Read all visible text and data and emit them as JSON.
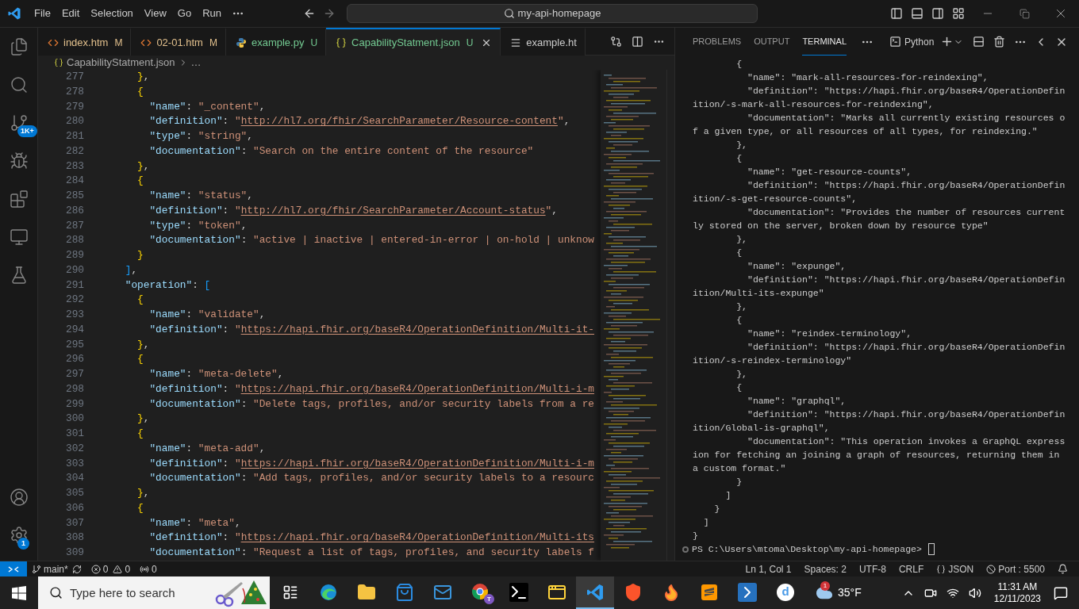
{
  "title_bar": {
    "menu": [
      "File",
      "Edit",
      "Selection",
      "View",
      "Go",
      "Run"
    ],
    "command_center": "my-api-homepage"
  },
  "activity_bar": {
    "top": [
      {
        "kind": "explorer"
      },
      {
        "kind": "search"
      },
      {
        "kind": "source_control",
        "badge": "1K+"
      },
      {
        "kind": "run"
      },
      {
        "kind": "extensions"
      },
      {
        "kind": "remote"
      },
      {
        "kind": "testing"
      }
    ],
    "bottom": [
      {
        "kind": "account"
      },
      {
        "kind": "settings",
        "badge": "1"
      }
    ]
  },
  "editor_tabs": [
    {
      "label": "index.htm",
      "kind": "html",
      "status": "M",
      "color": "#e2c08d",
      "selected": false
    },
    {
      "label": "02-01.htm",
      "kind": "html",
      "status": "M",
      "color": "#e2c08d",
      "selected": false
    },
    {
      "label": "example.py",
      "kind": "python",
      "status": "U",
      "color": "#73c991",
      "selected": false
    },
    {
      "label": "CapabilityStatment.json",
      "kind": "json",
      "status": "U",
      "color": "#73c991",
      "selected": true
    },
    {
      "label": "example.ht",
      "kind": "text",
      "color": "#cccccc",
      "selected": false
    }
  ],
  "breadcrumb": [
    "CapabilityStatment.json",
    "…"
  ],
  "editor": {
    "lines": [
      {
        "number": "277",
        "tokens": [
          {
            "kind": "close_brace",
            "text": "}"
          },
          {
            "kind": "punct",
            "text": ","
          }
        ]
      },
      {
        "number": "278",
        "tokens": [
          {
            "kind": "open_brace",
            "text": "{"
          }
        ]
      },
      {
        "number": "279",
        "tokens": [
          {
            "kind": "key",
            "text": "\"name\""
          },
          {
            "kind": "punct",
            "text": ": "
          },
          {
            "kind": "string",
            "text": "\"_content\""
          },
          {
            "kind": "punct",
            "text": ","
          }
        ]
      },
      {
        "number": "280",
        "tokens": [
          {
            "kind": "key",
            "text": "\"definition\""
          },
          {
            "kind": "punct",
            "text": ": "
          },
          {
            "kind": "string",
            "text": "\""
          },
          {
            "kind": "link",
            "text": "http://hl7.org/fhir/SearchParameter/Resource-content"
          },
          {
            "kind": "string",
            "text": "\""
          },
          {
            "kind": "punct",
            "text": ","
          }
        ]
      },
      {
        "number": "281",
        "tokens": [
          {
            "kind": "key",
            "text": "\"type\""
          },
          {
            "kind": "punct",
            "text": ": "
          },
          {
            "kind": "string",
            "text": "\"string\""
          },
          {
            "kind": "punct",
            "text": ","
          }
        ]
      },
      {
        "number": "282",
        "tokens": [
          {
            "kind": "key",
            "text": "\"documentation\""
          },
          {
            "kind": "punct",
            "text": ": "
          },
          {
            "kind": "string",
            "text": "\"Search on the entire content of the resource\""
          }
        ]
      },
      {
        "number": "283",
        "tokens": [
          {
            "kind": "close_brace",
            "text": "}"
          },
          {
            "kind": "punct",
            "text": ","
          }
        ]
      },
      {
        "number": "284",
        "tokens": [
          {
            "kind": "open_brace",
            "text": "{"
          }
        ]
      },
      {
        "number": "285",
        "tokens": [
          {
            "kind": "key",
            "text": "\"name\""
          },
          {
            "kind": "punct",
            "text": ": "
          },
          {
            "kind": "string",
            "text": "\"status\""
          },
          {
            "kind": "punct",
            "text": ","
          }
        ]
      },
      {
        "number": "286",
        "tokens": [
          {
            "kind": "key",
            "text": "\"definition\""
          },
          {
            "kind": "punct",
            "text": ": "
          },
          {
            "kind": "string",
            "text": "\""
          },
          {
            "kind": "link",
            "text": "http://hl7.org/fhir/SearchParameter/Account-status"
          },
          {
            "kind": "string",
            "text": "\""
          },
          {
            "kind": "punct",
            "text": ","
          }
        ]
      },
      {
        "number": "287",
        "tokens": [
          {
            "kind": "key",
            "text": "\"type\""
          },
          {
            "kind": "punct",
            "text": ": "
          },
          {
            "kind": "string",
            "text": "\"token\""
          },
          {
            "kind": "punct",
            "text": ","
          }
        ]
      },
      {
        "number": "288",
        "tokens": [
          {
            "kind": "key",
            "text": "\"documentation\""
          },
          {
            "kind": "punct",
            "text": ": "
          },
          {
            "kind": "string",
            "text": "\"active | inactive | entered-in-error | on-hold | unknow"
          }
        ]
      },
      {
        "number": "289",
        "tokens": [
          {
            "kind": "close_brace",
            "text": "}"
          }
        ]
      },
      {
        "number": "290",
        "tokens": [
          {
            "kind": "close_bracket",
            "text": "]"
          },
          {
            "kind": "punct",
            "text": ","
          }
        ]
      },
      {
        "number": "291",
        "tokens": [
          {
            "kind": "key",
            "text": "\"operation\""
          },
          {
            "kind": "punct",
            "text": ": "
          },
          {
            "kind": "open_bracket",
            "text": "["
          }
        ]
      },
      {
        "number": "292",
        "tokens": [
          {
            "kind": "open_brace",
            "text": "{"
          }
        ]
      },
      {
        "number": "293",
        "tokens": [
          {
            "kind": "key",
            "text": "\"name\""
          },
          {
            "kind": "punct",
            "text": ": "
          },
          {
            "kind": "string",
            "text": "\"validate\""
          },
          {
            "kind": "punct",
            "text": ","
          }
        ]
      },
      {
        "number": "294",
        "tokens": [
          {
            "kind": "key",
            "text": "\"definition\""
          },
          {
            "kind": "punct",
            "text": ": "
          },
          {
            "kind": "string",
            "text": "\""
          },
          {
            "kind": "link",
            "text": "https://hapi.fhir.org/baseR4/OperationDefinition/Multi-it-"
          }
        ]
      },
      {
        "number": "295",
        "tokens": [
          {
            "kind": "close_brace",
            "text": "}"
          },
          {
            "kind": "punct",
            "text": ","
          }
        ]
      },
      {
        "number": "296",
        "tokens": [
          {
            "kind": "open_brace",
            "text": "{"
          }
        ]
      },
      {
        "number": "297",
        "tokens": [
          {
            "kind": "key",
            "text": "\"name\""
          },
          {
            "kind": "punct",
            "text": ": "
          },
          {
            "kind": "string",
            "text": "\"meta-delete\""
          },
          {
            "kind": "punct",
            "text": ","
          }
        ]
      },
      {
        "number": "298",
        "tokens": [
          {
            "kind": "key",
            "text": "\"definition\""
          },
          {
            "kind": "punct",
            "text": ": "
          },
          {
            "kind": "string",
            "text": "\""
          },
          {
            "kind": "link",
            "text": "https://hapi.fhir.org/baseR4/OperationDefinition/Multi-i-m"
          }
        ]
      },
      {
        "number": "299",
        "tokens": [
          {
            "kind": "key",
            "text": "\"documentation\""
          },
          {
            "kind": "punct",
            "text": ": "
          },
          {
            "kind": "string",
            "text": "\"Delete tags, profiles, and/or security labels from a re"
          }
        ]
      },
      {
        "number": "300",
        "tokens": [
          {
            "kind": "close_brace",
            "text": "}"
          },
          {
            "kind": "punct",
            "text": ","
          }
        ]
      },
      {
        "number": "301",
        "tokens": [
          {
            "kind": "open_brace",
            "text": "{"
          }
        ]
      },
      {
        "number": "302",
        "tokens": [
          {
            "kind": "key",
            "text": "\"name\""
          },
          {
            "kind": "punct",
            "text": ": "
          },
          {
            "kind": "string",
            "text": "\"meta-add\""
          },
          {
            "kind": "punct",
            "text": ","
          }
        ]
      },
      {
        "number": "303",
        "tokens": [
          {
            "kind": "key",
            "text": "\"definition\""
          },
          {
            "kind": "punct",
            "text": ": "
          },
          {
            "kind": "string",
            "text": "\""
          },
          {
            "kind": "link",
            "text": "https://hapi.fhir.org/baseR4/OperationDefinition/Multi-i-m"
          }
        ]
      },
      {
        "number": "304",
        "tokens": [
          {
            "kind": "key",
            "text": "\"documentation\""
          },
          {
            "kind": "punct",
            "text": ": "
          },
          {
            "kind": "string",
            "text": "\"Add tags, profiles, and/or security labels to a resourc"
          }
        ]
      },
      {
        "number": "305",
        "tokens": [
          {
            "kind": "close_brace",
            "text": "}"
          },
          {
            "kind": "punct",
            "text": ","
          }
        ]
      },
      {
        "number": "306",
        "tokens": [
          {
            "kind": "open_brace",
            "text": "{"
          }
        ]
      },
      {
        "number": "307",
        "tokens": [
          {
            "kind": "key",
            "text": "\"name\""
          },
          {
            "kind": "punct",
            "text": ": "
          },
          {
            "kind": "string",
            "text": "\"meta\""
          },
          {
            "kind": "punct",
            "text": ","
          }
        ]
      },
      {
        "number": "308",
        "tokens": [
          {
            "kind": "key",
            "text": "\"definition\""
          },
          {
            "kind": "punct",
            "text": ": "
          },
          {
            "kind": "string",
            "text": "\""
          },
          {
            "kind": "link",
            "text": "https://hapi.fhir.org/baseR4/OperationDefinition/Multi-its"
          }
        ]
      },
      {
        "number": "309",
        "tokens": [
          {
            "kind": "key",
            "text": "\"documentation\""
          },
          {
            "kind": "punct",
            "text": ": "
          },
          {
            "kind": "string",
            "text": "\"Request a list of tags, profiles, and security labels f"
          }
        ]
      }
    ]
  },
  "panel": {
    "tabs": [
      {
        "label": "PROBLEMS",
        "selected": false
      },
      {
        "label": "OUTPUT",
        "selected": false
      },
      {
        "label": "TERMINAL",
        "selected": true
      }
    ],
    "terminal_profile": "Python",
    "terminal_lines": [
      "        {",
      "          \"name\": \"mark-all-resources-for-reindexing\",",
      "          \"definition\": \"https://hapi.fhir.org/baseR4/OperationDefin",
      "ition/-s-mark-all-resources-for-reindexing\",",
      "          \"documentation\": \"Marks all currently existing resources o",
      "f a given type, or all resources of all types, for reindexing.\"",
      "        },",
      "        {",
      "          \"name\": \"get-resource-counts\",",
      "          \"definition\": \"https://hapi.fhir.org/baseR4/OperationDefin",
      "ition/-s-get-resource-counts\",",
      "          \"documentation\": \"Provides the number of resources current",
      "ly stored on the server, broken down by resource type\"",
      "        },",
      "        {",
      "          \"name\": \"expunge\",",
      "          \"definition\": \"https://hapi.fhir.org/baseR4/OperationDefin",
      "ition/Multi-its-expunge\"",
      "        },",
      "        {",
      "          \"name\": \"reindex-terminology\",",
      "          \"definition\": \"https://hapi.fhir.org/baseR4/OperationDefin",
      "ition/-s-reindex-terminology\"",
      "        },",
      "        {",
      "          \"name\": \"graphql\",",
      "          \"definition\": \"https://hapi.fhir.org/baseR4/OperationDefin",
      "ition/Global-is-graphql\",",
      "          \"documentation\": \"This operation invokes a GraphQL express",
      "ion for fetching an joining a graph of resources, returning them in",
      "a custom format.\"",
      "        }",
      "      ]",
      "    }",
      "  ]",
      "}"
    ],
    "prompt": "PS C:\\Users\\mtoma\\Desktop\\my-api-homepage>"
  },
  "status_bar": {
    "branch": "main*",
    "errors": "0",
    "warnings": "0",
    "ports": "0",
    "items": [
      {
        "kind": "text",
        "text": "Ln 1, Col 1"
      },
      {
        "kind": "text",
        "text": "Spaces: 2"
      },
      {
        "kind": "text",
        "text": "UTF-8"
      },
      {
        "kind": "text",
        "text": "CRLF"
      },
      {
        "kind": "language",
        "text": "JSON"
      },
      {
        "kind": "port",
        "text": "Port : 5500"
      }
    ]
  },
  "taskbar": {
    "search_placeholder": "Type here to search",
    "apps": [
      {
        "kind": "task_view",
        "selected": false
      },
      {
        "kind": "edge",
        "selected": false
      },
      {
        "kind": "explorer",
        "selected": false
      },
      {
        "kind": "store",
        "selected": false
      },
      {
        "kind": "mail",
        "selected": false
      },
      {
        "kind": "chrome",
        "badge": "T",
        "selected": false
      },
      {
        "kind": "terminal",
        "selected": false
      },
      {
        "kind": "python",
        "selected": false
      },
      {
        "kind": "vscode",
        "selected": true
      },
      {
        "kind": "brave",
        "selected": false
      },
      {
        "kind": "firefox",
        "selected": false
      },
      {
        "kind": "sublime",
        "selected": false
      },
      {
        "kind": "powershell",
        "selected": false
      },
      {
        "kind": "letter",
        "glyph": "d",
        "selected": false
      }
    ],
    "weather": {
      "badge": "1",
      "temperature": "35°F"
    },
    "time": "11:31 AM",
    "date": "12/11/2023"
  }
}
